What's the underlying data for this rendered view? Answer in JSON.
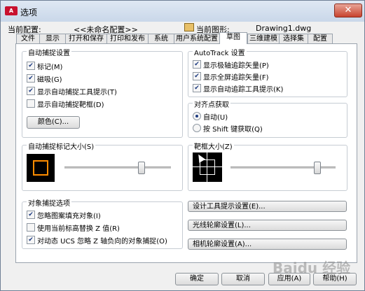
{
  "window": {
    "title": "选项",
    "close_glyph": "✕",
    "app_icon_text": "A"
  },
  "header": {
    "current_profile_label": "当前配置:",
    "current_profile_value": "<<未命名配置>>",
    "current_drawing_label": "当前图形:",
    "current_drawing_value": "Drawing1.dwg"
  },
  "tabs": [
    {
      "label": "文件"
    },
    {
      "label": "显示"
    },
    {
      "label": "打开和保存"
    },
    {
      "label": "打印和发布"
    },
    {
      "label": "系统"
    },
    {
      "label": "用户系统配置"
    },
    {
      "label": "草图"
    },
    {
      "label": "三维建模"
    },
    {
      "label": "选择集"
    },
    {
      "label": "配置"
    }
  ],
  "autosnap": {
    "title": "自动捕捉设置",
    "items": [
      {
        "label": "标记(M)",
        "checked": true
      },
      {
        "label": "磁吸(G)",
        "checked": true
      },
      {
        "label": "显示自动捕捉工具提示(T)",
        "checked": true
      },
      {
        "label": "显示自动捕捉靶框(D)",
        "checked": false
      }
    ],
    "color_button": "颜色(C)..."
  },
  "autotrack": {
    "title": "AutoTrack 设置",
    "items": [
      {
        "label": "显示极轴追踪矢量(P)",
        "checked": true
      },
      {
        "label": "显示全屏追踪矢量(F)",
        "checked": true
      },
      {
        "label": "显示自动追踪工具提示(K)",
        "checked": true
      }
    ]
  },
  "alignment": {
    "title": "对齐点获取",
    "options": [
      {
        "label": "自动(U)",
        "selected": true
      },
      {
        "label": "按 Shift 键获取(Q)",
        "selected": false
      }
    ]
  },
  "marker_size": {
    "title": "自动捕捉标记大小(S)",
    "slider_fraction": 0.71,
    "marker_color": "#ff8c00"
  },
  "aperture_size": {
    "title": "靶框大小(Z)",
    "slider_fraction": 0.9
  },
  "osnap": {
    "title": "对象捕捉选项",
    "items": [
      {
        "label": "忽略图案填充对象(I)",
        "checked": true
      },
      {
        "label": "使用当前标高替换 Z 值(R)",
        "checked": false
      },
      {
        "label": "对动态 UCS 忽略 Z 轴负向的对象捕捉(O)",
        "checked": true
      }
    ]
  },
  "right_buttons": [
    {
      "label": "设计工具提示设置(E)..."
    },
    {
      "label": "光线轮廓设置(L)..."
    },
    {
      "label": "相机轮廓设置(A)..."
    }
  ],
  "footer": {
    "ok": "确定",
    "cancel": "取消",
    "apply": "应用(A)",
    "help": "帮助(H)"
  },
  "watermark": "Baidu 经验"
}
